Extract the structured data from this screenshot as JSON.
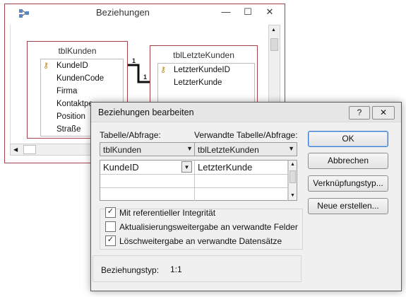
{
  "background_window": {
    "title": "Beziehungen",
    "controls": {
      "minimize": "—",
      "maximize": "☐",
      "close": "✕"
    },
    "table_left": {
      "title": "tblKunden",
      "fields": [
        "KundeID",
        "KundenCode",
        "Firma",
        "Kontaktpe",
        "Position",
        "Straße"
      ]
    },
    "table_right": {
      "title": "tblLetzteKunden",
      "fields": [
        "LetzterKundeID",
        "LetzterKunde"
      ]
    },
    "relation_labels": {
      "left": "1",
      "right": "1"
    }
  },
  "dialog": {
    "title": "Beziehungen bearbeiten",
    "help_label": "?",
    "close_label": "✕",
    "table_label": "Tabelle/Abfrage:",
    "related_label": "Verwandte Tabelle/Abfrage:",
    "table_value": "tblKunden",
    "related_value": "tblLetzteKunden",
    "grid_rows": [
      {
        "left": "KundeID",
        "right": "LetzterKunde"
      },
      {
        "left": "",
        "right": ""
      },
      {
        "left": "",
        "right": ""
      }
    ],
    "checkboxes": [
      {
        "label": "Mit referentieller Integrität",
        "checked": true
      },
      {
        "label": "Aktualisierungsweitergabe an verwandte Felder",
        "checked": false
      },
      {
        "label": "Löschweitergabe an verwandte Datensätze",
        "checked": true
      }
    ],
    "relationship_type_label": "Beziehungstyp:",
    "relationship_type_value": "1:1",
    "buttons": {
      "ok": "OK",
      "cancel": "Abbrechen",
      "join_type": "Verknüpfungstyp...",
      "create_new": "Neue erstellen..."
    }
  },
  "colors": {
    "accent_border": "#a0434b",
    "dialog_bg": "#f0f0f0",
    "ok_focus": "#3d7bca"
  }
}
